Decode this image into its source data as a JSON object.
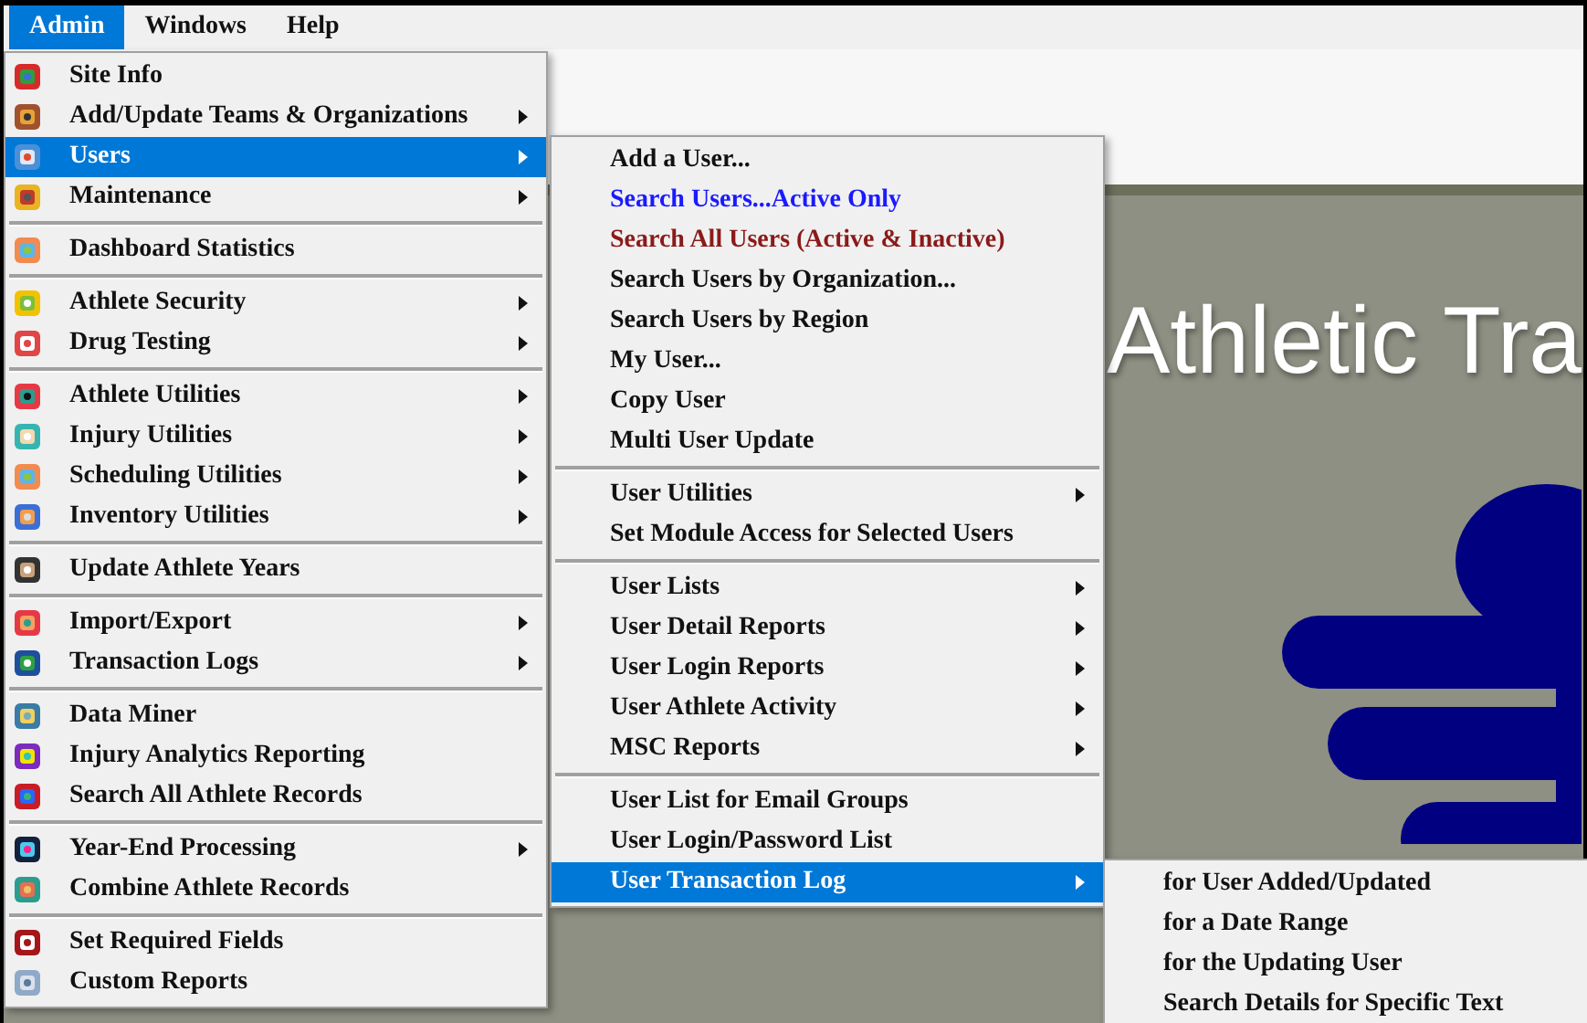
{
  "menubar": [
    {
      "label": "Admin",
      "selected": true
    },
    {
      "label": "Windows",
      "selected": false
    },
    {
      "label": "Help",
      "selected": false
    }
  ],
  "admin_menu": {
    "groups": [
      [
        {
          "label": "Site Info",
          "submenu": false,
          "selected": false
        },
        {
          "label": "Add/Update Teams & Organizations",
          "submenu": true,
          "selected": false
        },
        {
          "label": "Users",
          "submenu": true,
          "selected": true
        },
        {
          "label": "Maintenance",
          "submenu": true,
          "selected": false
        }
      ],
      [
        {
          "label": "Dashboard Statistics",
          "submenu": false,
          "selected": false
        }
      ],
      [
        {
          "label": "Athlete Security",
          "submenu": true,
          "selected": false
        },
        {
          "label": "Drug Testing",
          "submenu": true,
          "selected": false
        }
      ],
      [
        {
          "label": "Athlete Utilities",
          "submenu": true,
          "selected": false
        },
        {
          "label": "Injury Utilities",
          "submenu": true,
          "selected": false
        },
        {
          "label": "Scheduling Utilities",
          "submenu": true,
          "selected": false
        },
        {
          "label": "Inventory Utilities",
          "submenu": true,
          "selected": false
        }
      ],
      [
        {
          "label": "Update Athlete Years",
          "submenu": false,
          "selected": false
        }
      ],
      [
        {
          "label": "Import/Export",
          "submenu": true,
          "selected": false
        },
        {
          "label": "Transaction Logs",
          "submenu": true,
          "selected": false
        }
      ],
      [
        {
          "label": "Data Miner",
          "submenu": false,
          "selected": false
        },
        {
          "label": "Injury Analytics Reporting",
          "submenu": false,
          "selected": false
        },
        {
          "label": "Search All Athlete Records",
          "submenu": false,
          "selected": false
        }
      ],
      [
        {
          "label": "Year-End Processing",
          "submenu": true,
          "selected": false
        },
        {
          "label": "Combine Athlete Records",
          "submenu": false,
          "selected": false
        }
      ],
      [
        {
          "label": "Set Required Fields",
          "submenu": false,
          "selected": false
        },
        {
          "label": "Custom Reports",
          "submenu": false,
          "selected": false
        }
      ]
    ]
  },
  "users_menu": {
    "groups": [
      [
        {
          "label": "Add a User...",
          "submenu": false,
          "selected": false
        },
        {
          "label": "Search Users...Active Only",
          "submenu": false,
          "selected": false,
          "color": "#1a1aff"
        },
        {
          "label": "Search All Users (Active & Inactive)",
          "submenu": false,
          "selected": false,
          "color": "#8b1a1a"
        },
        {
          "label": "Search Users by Organization...",
          "submenu": false,
          "selected": false
        },
        {
          "label": "Search Users by Region",
          "submenu": false,
          "selected": false
        },
        {
          "label": "My User...",
          "submenu": false,
          "selected": false
        },
        {
          "label": "Copy User",
          "submenu": false,
          "selected": false
        },
        {
          "label": "Multi User Update",
          "submenu": false,
          "selected": false
        }
      ],
      [
        {
          "label": "User Utilities",
          "submenu": true,
          "selected": false
        },
        {
          "label": "Set Module Access for Selected Users",
          "submenu": false,
          "selected": false
        }
      ],
      [
        {
          "label": "User Lists",
          "submenu": true,
          "selected": false
        },
        {
          "label": "User Detail Reports",
          "submenu": true,
          "selected": false
        },
        {
          "label": "User Login Reports",
          "submenu": true,
          "selected": false
        },
        {
          "label": "User Athlete Activity",
          "submenu": true,
          "selected": false
        },
        {
          "label": "MSC Reports",
          "submenu": true,
          "selected": false
        }
      ],
      [
        {
          "label": "User List for Email Groups",
          "submenu": false,
          "selected": false
        },
        {
          "label": "User Login/Password List",
          "submenu": false,
          "selected": false
        },
        {
          "label": "User Transaction Log",
          "submenu": true,
          "selected": true
        }
      ]
    ]
  },
  "transaction_log_menu": {
    "items": [
      {
        "label": "for User Added/Updated",
        "submenu": false,
        "selected": false
      },
      {
        "label": "for a Date Range",
        "submenu": false,
        "selected": false
      },
      {
        "label": "for the Updating User",
        "submenu": false,
        "selected": false
      },
      {
        "label": "Search Details for Specific Text",
        "submenu": false,
        "selected": false
      }
    ]
  },
  "banner": {
    "title": "Athletic Tra"
  }
}
